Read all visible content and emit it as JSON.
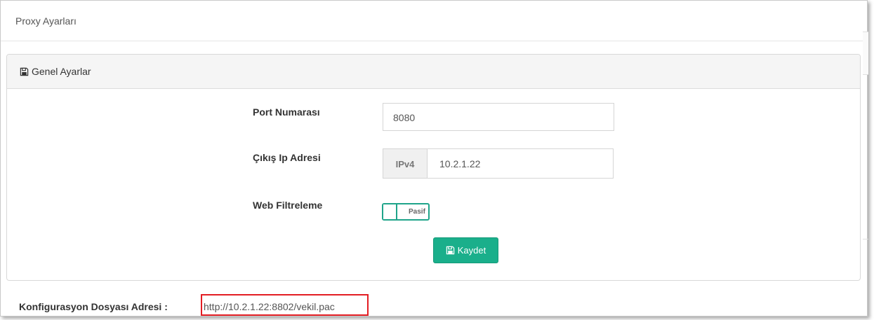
{
  "page": {
    "title": "Proxy Ayarları"
  },
  "panel": {
    "heading": "Genel Ayarlar",
    "heading_icon": "floppy-disk-icon"
  },
  "form": {
    "port": {
      "label": "Port Numarası",
      "value": "8080"
    },
    "exit_ip": {
      "label": "Çıkış Ip Adresi",
      "addon": "IPv4",
      "value": "10.2.1.22"
    },
    "web_filter": {
      "label": "Web Filtreleme",
      "state_label": "Pasif",
      "enabled": false
    },
    "save_button": {
      "label": "Kaydet",
      "icon": "floppy-disk-icon"
    }
  },
  "config": {
    "label": "Konfigurasyon Dosyası Adresi  :",
    "url": "http://10.2.1.22:8802/vekil.pac",
    "highlight_color": "#e31d23"
  },
  "colors": {
    "accent": "#1aaf8b",
    "switch_border": "#1fa48a"
  }
}
